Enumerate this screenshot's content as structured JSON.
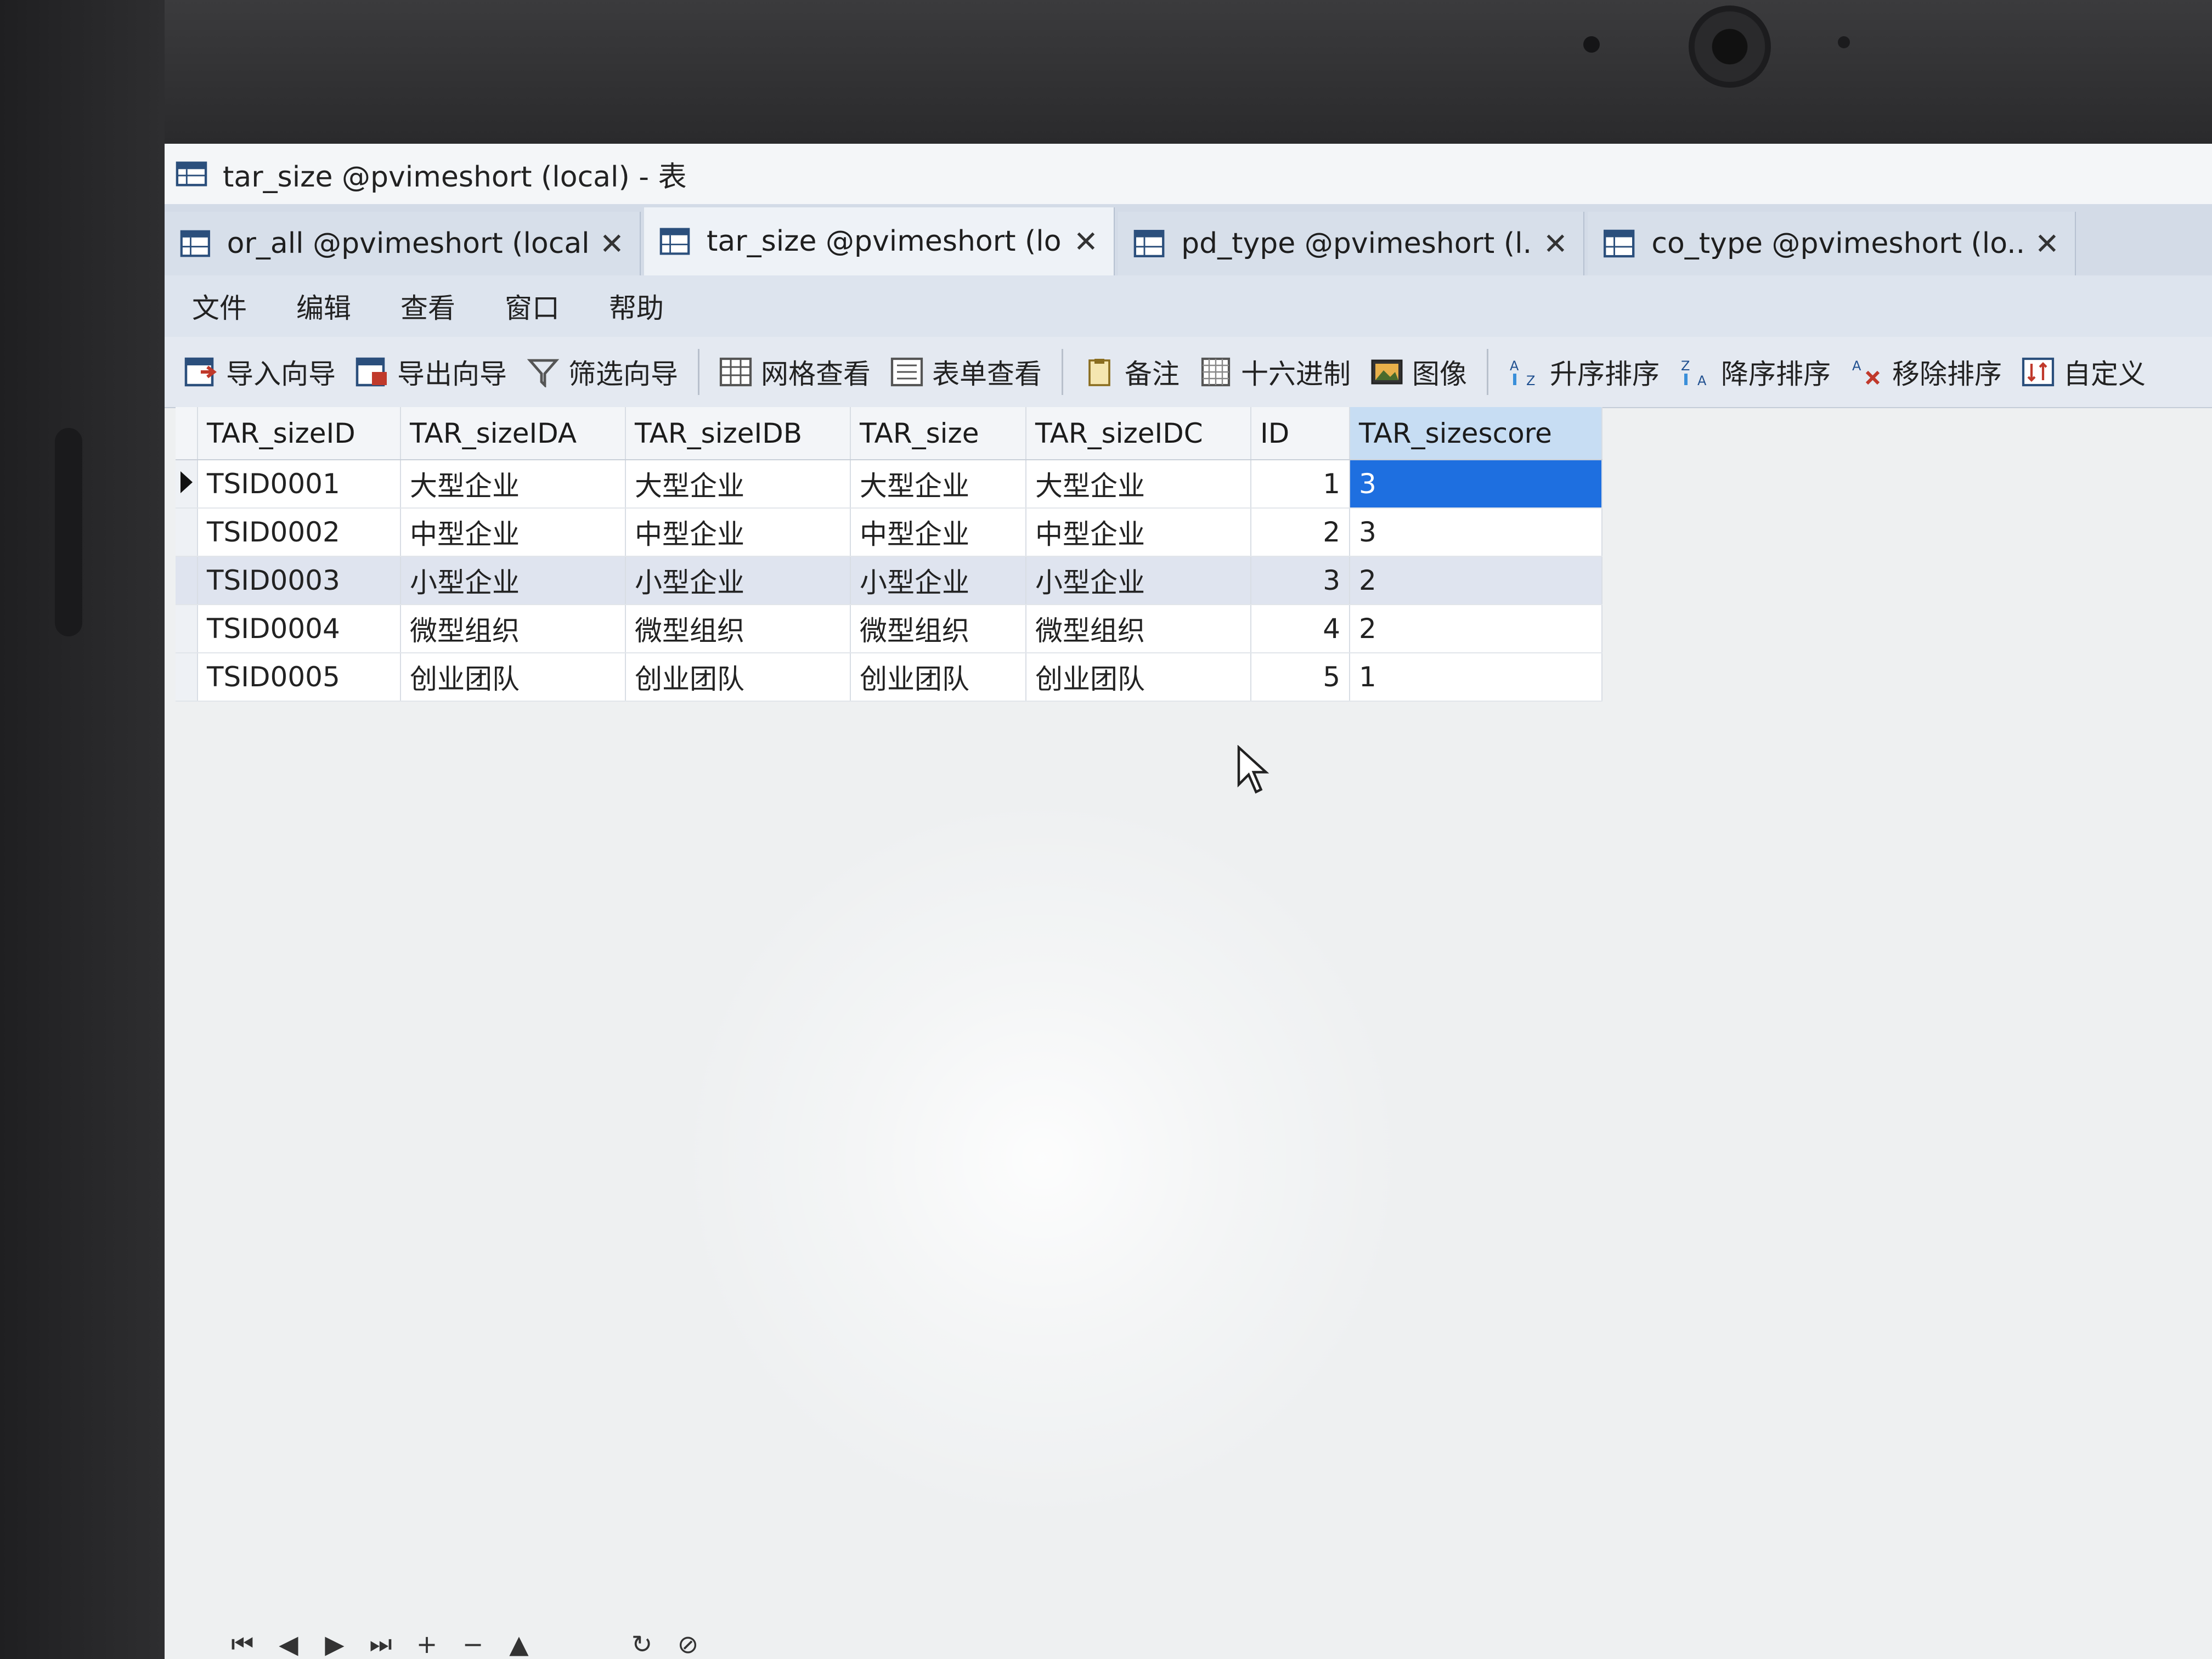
{
  "window": {
    "title": "tar_size @pvimeshort (local) - 表"
  },
  "tabs": [
    {
      "label": "or_all @pvimeshort (local...",
      "close": "✕",
      "active": false
    },
    {
      "label": "tar_size @pvimeshort (lo...",
      "close": "✕",
      "active": true
    },
    {
      "label": "pd_type @pvimeshort (l...",
      "close": "✕",
      "active": false
    },
    {
      "label": "co_type @pvimeshort (lo...",
      "close": "✕",
      "active": false
    }
  ],
  "menu": [
    "文件",
    "编辑",
    "查看",
    "窗口",
    "帮助"
  ],
  "toolbar": [
    {
      "label": "导入向导",
      "icon": "import-wizard-icon"
    },
    {
      "label": "导出向导",
      "icon": "export-wizard-icon"
    },
    {
      "label": "筛选向导",
      "icon": "filter-icon"
    },
    {
      "label": "网格查看",
      "icon": "grid-view-icon"
    },
    {
      "label": "表单查看",
      "icon": "form-view-icon"
    },
    {
      "label": "备注",
      "icon": "memo-icon"
    },
    {
      "label": "十六进制",
      "icon": "hex-icon"
    },
    {
      "label": "图像",
      "icon": "image-icon"
    },
    {
      "label": "升序排序",
      "icon": "sort-ascending-icon"
    },
    {
      "label": "降序排序",
      "icon": "sort-descending-icon"
    },
    {
      "label": "移除排序",
      "icon": "remove-sort-icon"
    },
    {
      "label": "自定义",
      "icon": "custom-sort-icon"
    }
  ],
  "grid": {
    "columns": [
      "TAR_sizeID",
      "TAR_sizeIDA",
      "TAR_sizeIDB",
      "TAR_size",
      "TAR_sizeIDC",
      "ID",
      "TAR_sizescore"
    ],
    "rows": [
      [
        "TSID0001",
        "大型企业",
        "大型企业",
        "大型企业",
        "大型企业",
        "1",
        "3"
      ],
      [
        "TSID0002",
        "中型企业",
        "中型企业",
        "中型企业",
        "中型企业",
        "2",
        "3"
      ],
      [
        "TSID0003",
        "小型企业",
        "小型企业",
        "小型企业",
        "小型企业",
        "3",
        "2"
      ],
      [
        "TSID0004",
        "微型组织",
        "微型组织",
        "微型组织",
        "微型组织",
        "4",
        "2"
      ],
      [
        "TSID0005",
        "创业团队",
        "创业团队",
        "创业团队",
        "创业团队",
        "5",
        "1"
      ]
    ],
    "current_row": 0,
    "highlighted_row": 2
  },
  "navigation": [
    "⏮",
    "◀",
    "▶",
    "⏭",
    "+",
    "−",
    "▲",
    "↻",
    "⊘"
  ],
  "colors": {
    "selected_cell": "#1e6fe0",
    "sorted_header": "#c7ddf3",
    "highlight_row": "#dfe4ef"
  }
}
